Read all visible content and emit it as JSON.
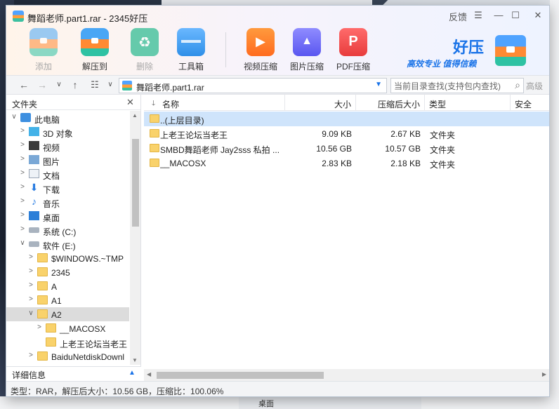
{
  "window": {
    "title": "舞蹈老师.part1.rar - 2345好压",
    "feedback": "反馈",
    "menu": "☰",
    "minimize": "—",
    "maximize": "☐",
    "close": "✕"
  },
  "background": {
    "taskbar_item": "桌面"
  },
  "toolbar": {
    "tools": [
      {
        "label": "添加",
        "icon": "archive-add-icon",
        "enabled": false
      },
      {
        "label": "解压到",
        "icon": "archive-extract-icon",
        "enabled": true
      },
      {
        "label": "删除",
        "icon": "recycle-icon",
        "enabled": false
      },
      {
        "label": "工具箱",
        "icon": "toolbox-icon",
        "enabled": true
      },
      {
        "label": "视频压缩",
        "icon": "video-compress-icon",
        "enabled": true
      },
      {
        "label": "图片压缩",
        "icon": "image-compress-icon",
        "enabled": true
      },
      {
        "label": "PDF压缩",
        "icon": "pdf-compress-icon",
        "enabled": true
      }
    ]
  },
  "brand": {
    "name": "好压",
    "slogan": "高效专业  值得信赖"
  },
  "address": {
    "back": "←",
    "forward": "→",
    "dropdown": "∨",
    "up": "↑",
    "view": "☷",
    "path": "舞蹈老师.part1.rar",
    "path_dropdown": "▼",
    "search_placeholder": "当前目录查找(支持包内查找)",
    "search_icon": "⌕",
    "advanced": "高级"
  },
  "left_pane": {
    "header": "文件夹",
    "close": "✕",
    "tree": [
      {
        "label": "此电脑",
        "toggle": "∨",
        "icon": "pc",
        "level": 0
      },
      {
        "label": "3D 对象",
        "toggle": ">",
        "icon": "3d",
        "level": 1
      },
      {
        "label": "视频",
        "toggle": ">",
        "icon": "video",
        "level": 1
      },
      {
        "label": "图片",
        "toggle": ">",
        "icon": "pic",
        "level": 1
      },
      {
        "label": "文档",
        "toggle": ">",
        "icon": "doc",
        "level": 1
      },
      {
        "label": "下载",
        "toggle": ">",
        "icon": "dl",
        "level": 1
      },
      {
        "label": "音乐",
        "toggle": ">",
        "icon": "music",
        "level": 1
      },
      {
        "label": "桌面",
        "toggle": ">",
        "icon": "desk",
        "level": 1
      },
      {
        "label": "系统 (C:)",
        "toggle": ">",
        "icon": "drive",
        "level": 1
      },
      {
        "label": "软件 (E:)",
        "toggle": "∨",
        "icon": "drive",
        "level": 1
      },
      {
        "label": "$WINDOWS.~TMP",
        "toggle": ">",
        "icon": "folder",
        "level": 2
      },
      {
        "label": "2345",
        "toggle": ">",
        "icon": "folder",
        "level": 2
      },
      {
        "label": "A",
        "toggle": ">",
        "icon": "folder",
        "level": 2
      },
      {
        "label": "A1",
        "toggle": ">",
        "icon": "folder",
        "level": 2
      },
      {
        "label": "A2",
        "toggle": "∨",
        "icon": "folder",
        "level": 2,
        "selected": true
      },
      {
        "label": "__MACOSX",
        "toggle": ">",
        "icon": "folder",
        "level": 3
      },
      {
        "label": "上老王论坛当老王",
        "toggle": "",
        "icon": "folder",
        "level": 3
      },
      {
        "label": "BaiduNetdiskDownl",
        "toggle": ">",
        "icon": "folder",
        "level": 2
      }
    ],
    "details": "详细信息",
    "details_toggle": "▲"
  },
  "file_list": {
    "columns": {
      "name": "名称",
      "size": "大小",
      "packed": "压缩后大小",
      "type": "类型",
      "security": "安全"
    },
    "sort_indicator": "🡓",
    "rows": [
      {
        "name": "..(上层目录)",
        "size": "",
        "packed": "",
        "type": "",
        "highlight": true
      },
      {
        "name": "上老王论坛当老王",
        "size": "9.09 KB",
        "packed": "2.67 KB",
        "type": "文件夹"
      },
      {
        "name": "SMBD舞蹈老师 Jay2sss 私拍 ...",
        "size": "10.56 GB",
        "packed": "10.57 GB",
        "type": "文件夹"
      },
      {
        "name": "__MACOSX",
        "size": "2.83 KB",
        "packed": "2.18 KB",
        "type": "文件夹"
      }
    ]
  },
  "status": {
    "text": "类型：RAR，解压后大小：10.56 GB，压缩比：100.06%"
  }
}
